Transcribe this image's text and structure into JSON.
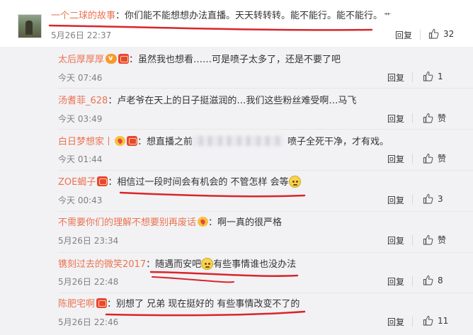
{
  "main_comment": {
    "username": "一个二球的故事",
    "text": "：你们能不能想想办法直播。天天转转转。能不能行。能不能行。",
    "tail": "艹",
    "time": "5月26日 22:37",
    "reply_label": "回复",
    "likes": "32"
  },
  "replies": [
    {
      "username": "太后厚厚厚",
      "badges": [
        "vip-badge",
        "crown-badge"
      ],
      "text": "：虽然我也想看……可是喷子太多了，还是不要了吧",
      "time": "今天 07:46",
      "reply_label": "回复",
      "likes": "1"
    },
    {
      "username": "汤耆菲_628",
      "badges": [],
      "text": "：卢老爷在天上的日子挺滋润的…我们这些粉丝难受啊…马飞",
      "time": "今天 03:49",
      "reply_label": "回复",
      "likes": "赞"
    },
    {
      "username": "白日梦想家丨",
      "badges": [
        "heart-badge",
        "crown-badge"
      ],
      "text_before": "：想直播之前",
      "text_after": "喷子全死干净，才有戏。",
      "time": "今天 01:44",
      "reply_label": "回复",
      "likes": "赞"
    },
    {
      "username": "ZOE蝎子",
      "badges": [
        "crown-badge"
      ],
      "text": "：相信过一段时间会有机会的 不管怎样 会等",
      "time": "今天 00:43",
      "reply_label": "回复",
      "likes": "3"
    },
    {
      "username": "不需要你们的理解不想要别再废话",
      "badges": [
        "heart-badge"
      ],
      "text": "：啊一真的很严格",
      "time": "5月26日 23:34",
      "reply_label": "回复",
      "likes": "赞"
    },
    {
      "username": "镌刻过去的微笑2017",
      "badges": [],
      "text_before": "：随遇而安吧",
      "text_after": "有些事情谁也没办法",
      "time": "5月26日 22:48",
      "reply_label": "回复",
      "likes": "8"
    },
    {
      "username": "陈肥宅啊",
      "badges": [
        "crown-badge"
      ],
      "text": "：别想了 兄弟 现在挺好的 有些事情改变不了的",
      "time": "5月26日 22:46",
      "reply_label": "回复",
      "likes": "11"
    }
  ],
  "colors": {
    "username": "#eb7350",
    "annotation": "#d9252a",
    "background": "#f2f2f5"
  }
}
